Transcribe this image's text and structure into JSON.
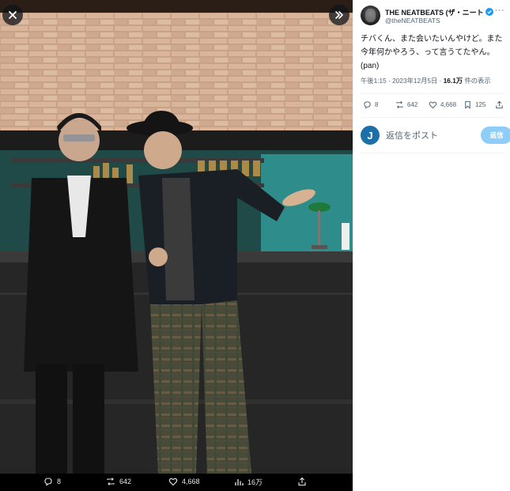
{
  "viewer": {
    "close_icon": "close-icon",
    "expand_icon": "chevron-double-right-icon",
    "bar": {
      "replies": "8",
      "reposts": "642",
      "likes": "4,668",
      "views": "16万"
    }
  },
  "tweet": {
    "display_name": "THE NEATBEATS (ザ・ニート",
    "handle": "@theNEATBEATS",
    "text": "チバくん、また会いたいんやけど。また今年何かやろう、って言うてたやん。(pan)",
    "time": "午後1:15 · 2023年12月5日 · ",
    "views_count": "16.1万",
    "views_label": " 件の表示",
    "stats": {
      "replies": "8",
      "reposts": "642",
      "likes": "4,668",
      "bookmarks": "125"
    }
  },
  "reply": {
    "avatar_letter": "J",
    "placeholder": "返信をポスト",
    "button": "返信"
  },
  "colors": {
    "accent": "#1d9bf0",
    "reply_button_disabled": "#8ecdf7",
    "secondary_text": "#536471"
  }
}
